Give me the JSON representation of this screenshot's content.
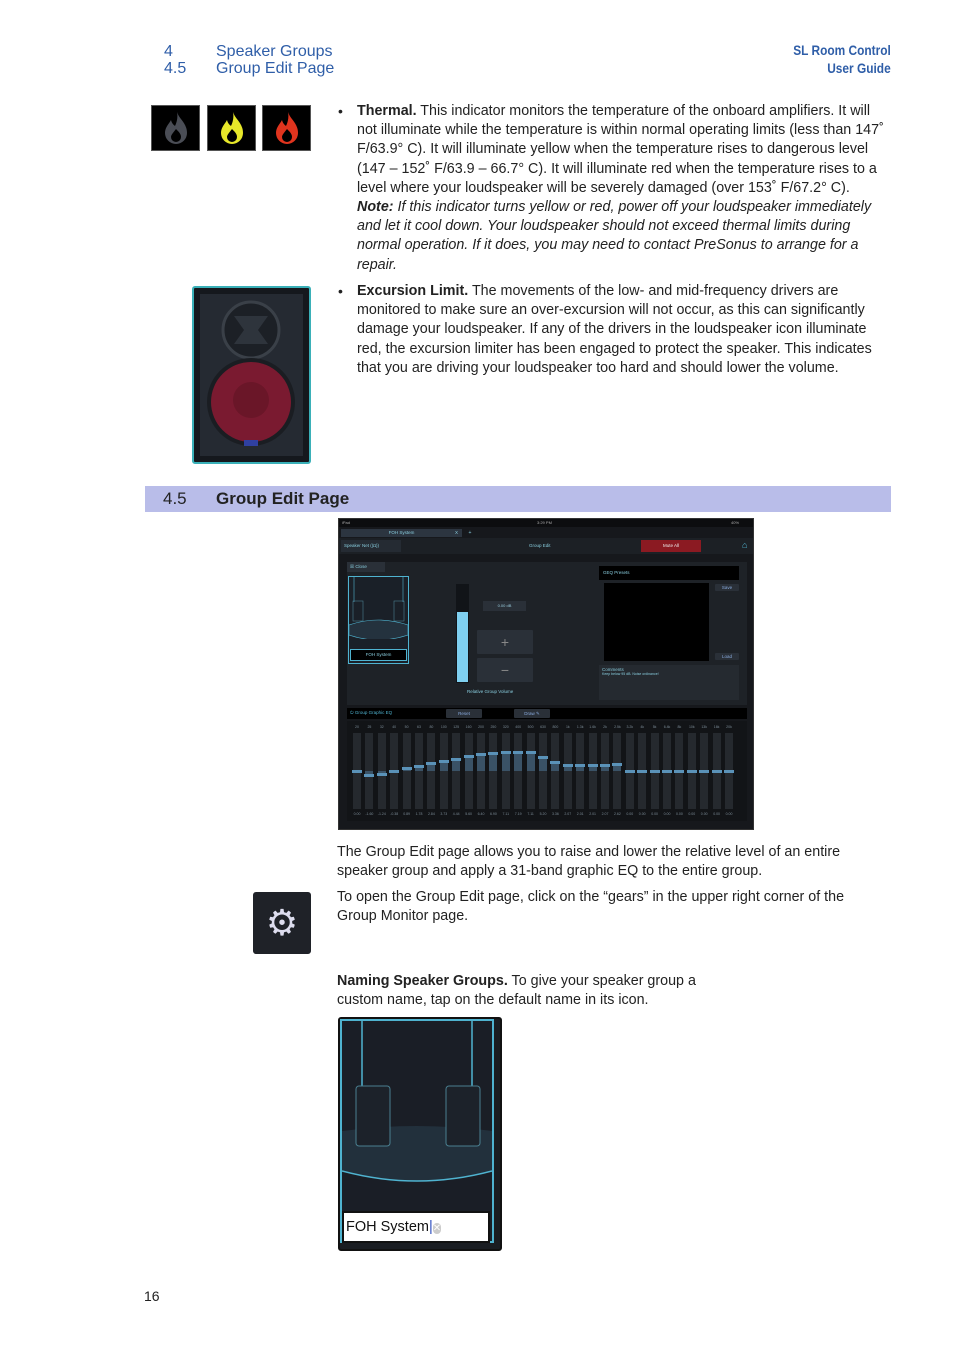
{
  "header": {
    "chapter_num": "4",
    "section_num": "4.5",
    "chapter_title": "Speaker Groups",
    "section_title": "Group Edit Page",
    "product": "SL Room Control",
    "doc": "User Guide"
  },
  "thermal": {
    "icons": [
      "flame-icon-gray",
      "flame-icon-yellow",
      "flame-icon-red"
    ],
    "title": "Thermal.",
    "body": " This indicator monitors the temperature of the onboard amplifiers. It will not illuminate while the temperature is within normal operating limits (less than 147˚ F/63.9° C). It will illuminate yellow when the temperature rises to dangerous level (147 – 152˚ F/63.9 – 66.7° C). It will illuminate red when the temperature rises to a level where your loudspeaker will be severely damaged (over 153˚ F/67.2° C). ",
    "note_label": "Note:",
    "note": " If this indicator turns yellow or red, power off your loudspeaker immediately and let it cool down. Your loudspeaker should not exceed thermal limits during normal operation. If it does, you may need to contact PreSonus to arrange for a repair."
  },
  "excursion": {
    "title": "Excursion Limit.",
    "body": " The movements of the low- and mid-frequency drivers are monitored to make sure an over-excursion will not occur, as this can significantly damage your loudspeaker. If any of the drivers in the loudspeaker icon illuminate red, the excursion limiter has been engaged to protect the speaker. This indicates that you are driving your loudspeaker too hard and should lower the volume."
  },
  "section_bar": {
    "num": "4.5",
    "title": "Group Edit Page"
  },
  "screenshot": {
    "status": {
      "left": "iPad",
      "time": "3:29 PM",
      "battery": "40%"
    },
    "tab": "FOH System",
    "tab_close": "X",
    "tab_add": "+",
    "speaker_net": "Speaker Net",
    "title": "Group Edit",
    "mute_all": "Mute All",
    "close": "Close",
    "group_name": "FOH System",
    "db": "0.00 dB",
    "plus": "+",
    "minus": "−",
    "volume_label": "Relative Group Volume",
    "volume_level": 0.72,
    "geq_presets": "GEQ Presets",
    "save": "Save",
    "load": "Load",
    "comments": "Comments",
    "comment_text": "Keep below 95 dB. Noise ordinance!",
    "eq_title": "Group Graphic EQ",
    "reset": "Reset",
    "draw": "Draw",
    "colors": {
      "mute": "#8b1a22",
      "accent": "#4fb3d0"
    }
  },
  "chart_data": {
    "type": "bar",
    "title": "Group Graphic EQ",
    "ylim": [
      -15,
      15
    ],
    "categories": [
      "20",
      "25",
      "32",
      "40",
      "50",
      "63",
      "80",
      "100",
      "125",
      "160",
      "200",
      "250",
      "320",
      "400",
      "500",
      "630",
      "800",
      "1k",
      "1.3k",
      "1.6k",
      "2k",
      "2.5k",
      "3.2k",
      "4k",
      "5k",
      "6.4k",
      "8k",
      "10k",
      "13k",
      "16k",
      "20k"
    ],
    "values": [
      0.0,
      -1.6,
      -1.24,
      -0.38,
      0.89,
      1.78,
      2.84,
      3.73,
      4.44,
      5.6,
      6.4,
      6.9,
      7.11,
      7.19,
      7.11,
      5.2,
      3.36,
      2.07,
      2.01,
      2.01,
      2.07,
      2.62,
      0.0,
      0.0,
      0.0,
      0.0,
      0.0,
      0.0,
      0.0,
      0.0,
      0.0
    ]
  },
  "para1": "The Group Edit page allows you to raise and lower the relative level of an entire speaker group and apply a 31-band graphic EQ to the entire group.",
  "para2": "To open the Group Edit page, click on the “gears” in the upper right corner of the Group Monitor page.",
  "naming": {
    "title": "Naming Speaker Groups.",
    "body": " To give your speaker group a custom name, tap on the default name in its icon."
  },
  "name_field": {
    "value": "FOH System"
  },
  "page_number": "16"
}
